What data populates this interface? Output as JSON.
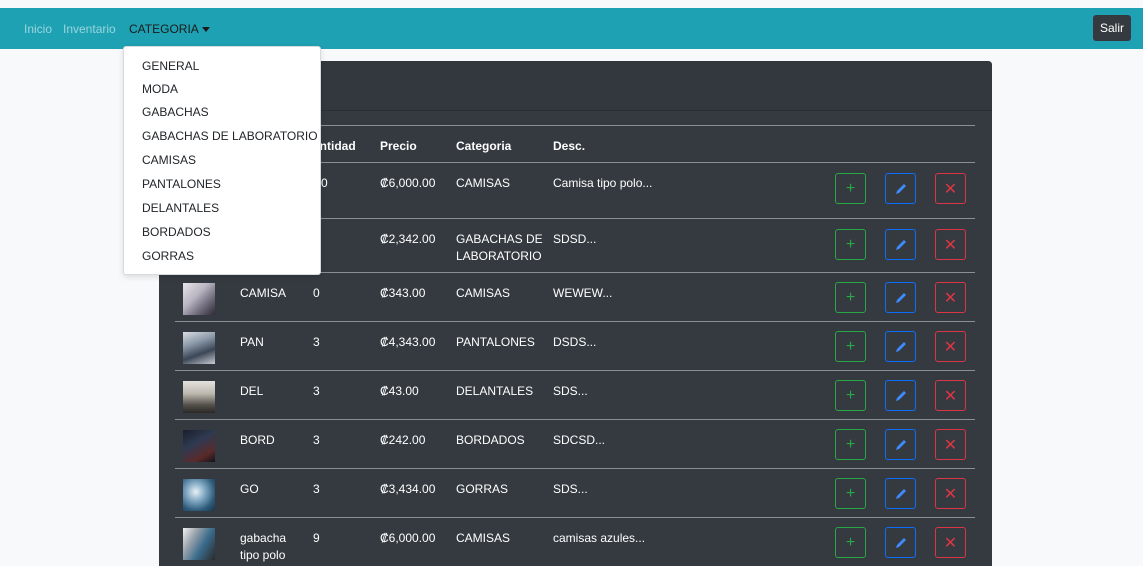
{
  "nav": {
    "links": [
      "Inicio",
      "Inventario"
    ],
    "active": "CATEGORIA",
    "logout": "Salir"
  },
  "card": {
    "title_visible": "AL"
  },
  "table": {
    "headers": {
      "cantidad_visible": "antidad",
      "precio": "Precio",
      "categoria": "Categoria",
      "desc": "Desc."
    },
    "rows": [
      {
        "name": "",
        "qty": "0",
        "price": "₡6,000.00",
        "category": "CAMISAS",
        "desc": "Camisa tipo polo..."
      },
      {
        "name": "",
        "qty": "",
        "price": "₡2,342.00",
        "category": "GABACHAS DE LABORATORIO",
        "desc": "SDSD..."
      },
      {
        "name": "CAMISA",
        "qty": "0",
        "price": "₡343.00",
        "category": "CAMISAS",
        "desc": "WEWEW..."
      },
      {
        "name": "PAN",
        "qty": "3",
        "price": "₡4,343.00",
        "category": "PANTALONES",
        "desc": "DSDS..."
      },
      {
        "name": "DEL",
        "qty": "3",
        "price": "₡43.00",
        "category": "DELANTALES",
        "desc": "SDS..."
      },
      {
        "name": "BORD",
        "qty": "3",
        "price": "₡242.00",
        "category": "BORDADOS",
        "desc": "SDCSD..."
      },
      {
        "name": "GO",
        "qty": "3",
        "price": "₡3,434.00",
        "category": "GORRAS",
        "desc": "SDS..."
      },
      {
        "name": "gabacha tipo polo",
        "qty": "9",
        "price": "₡6,000.00",
        "category": "CAMISAS",
        "desc": "camisas azules..."
      }
    ]
  },
  "dropdown": {
    "items": [
      "GENERAL",
      "MODA",
      "GABACHAS",
      "GABACHAS DE LABORATORIO",
      "CAMISAS",
      "PANTALONES",
      "DELANTALES",
      "BORDADOS",
      "GORRAS"
    ]
  },
  "icons": {
    "add": "plus-icon",
    "edit": "pencil-icon",
    "delete": "x-icon"
  },
  "colors": {
    "navbar": "#1ea1b3",
    "card": "#343a40",
    "add": "#28a745",
    "edit": "#0d6efd",
    "delete": "#dc3545"
  }
}
